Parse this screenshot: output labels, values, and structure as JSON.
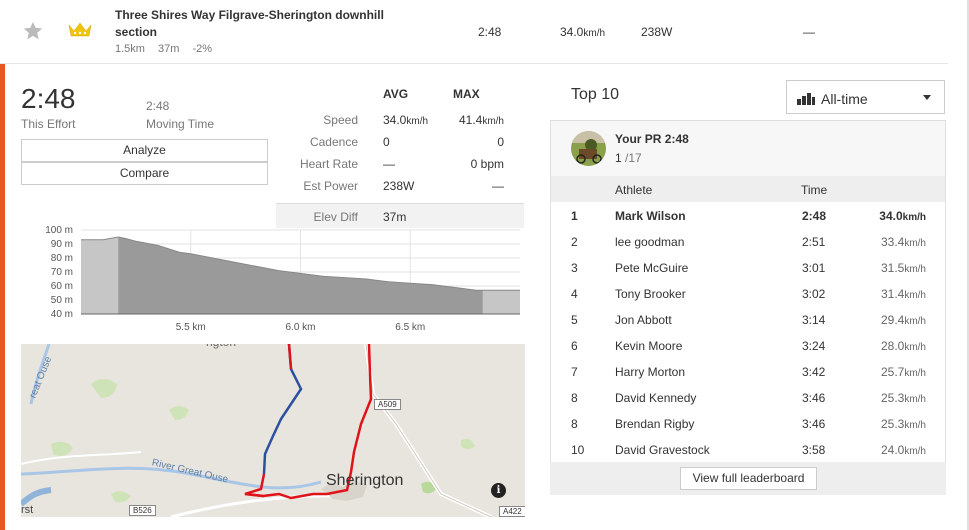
{
  "segment": {
    "name": "Three Shires Way Filgrave-Sherington downhill section",
    "distance": "1.5km",
    "elevation_gain": "37m",
    "grade": "-2%",
    "time": "2:48",
    "speed_value": "34.0",
    "speed_unit": "km/h",
    "power": "238W",
    "heart_rate": "—",
    "starred": false,
    "crown_color": "#f0c30f"
  },
  "effort": {
    "time": "2:48",
    "time_label": "This Effort",
    "moving_time": "2:48",
    "moving_time_label": "Moving Time",
    "analyze_label": "Analyze",
    "compare_label": "Compare"
  },
  "stats": {
    "avg_header": "AVG",
    "max_header": "MAX",
    "rows": [
      {
        "label": "Speed",
        "avg": "34.0",
        "avg_unit": "km/h",
        "max": "41.4",
        "max_unit": "km/h"
      },
      {
        "label": "Cadence",
        "avg": "0",
        "avg_unit": "",
        "max": "0",
        "max_unit": ""
      },
      {
        "label": "Heart Rate",
        "avg": "—",
        "avg_unit": "",
        "max": "0",
        "max_unit": " bpm"
      },
      {
        "label": "Est Power",
        "avg": "238W",
        "avg_unit": "",
        "max": "—",
        "max_unit": ""
      }
    ],
    "elev_label": "Elev Diff",
    "elev_value": "37m"
  },
  "chart_data": {
    "type": "area",
    "title": "",
    "xlabel": "",
    "ylabel": "",
    "x_ticks": [
      "5.5 km",
      "6.0 km",
      "6.5 km"
    ],
    "x_tick_values": [
      5.5,
      6.0,
      6.5
    ],
    "xlim": [
      5.0,
      7.0
    ],
    "y_ticks": [
      "100 m",
      "90 m",
      "80 m",
      "70 m",
      "60 m",
      "50 m",
      "40 m"
    ],
    "ylim": [
      40,
      100
    ],
    "grid": true,
    "highlight_range": [
      5.17,
      6.83
    ],
    "series": [
      {
        "x": [
          5.0,
          5.05,
          5.1,
          5.17,
          5.2,
          5.25,
          5.35,
          5.45,
          5.5,
          5.6,
          5.7,
          5.8,
          5.9,
          6.0,
          6.1,
          6.2,
          6.3,
          6.4,
          6.5,
          6.6,
          6.7,
          6.8,
          6.83,
          6.9,
          7.0
        ],
        "y": [
          93,
          93,
          93,
          95,
          94,
          92,
          89,
          84,
          83,
          80,
          77,
          74,
          71,
          69,
          67,
          66,
          65,
          63,
          62,
          61,
          59,
          57,
          57,
          57,
          57
        ]
      }
    ],
    "colors": {
      "area": "#c6c6c6",
      "area_highlight": "#9a9a9a",
      "line": "#888888"
    }
  },
  "map": {
    "town_label": "Sherington",
    "river_label": "River Great Ouse",
    "river_label_2": "reat Ouse",
    "road_a509": "A509",
    "road_b526": "B526",
    "road_a422": "A422",
    "info_icon": "i",
    "top_fragment": "ngton",
    "left_fragment": "rst"
  },
  "leaderboard": {
    "title": "Top 10",
    "period_label": "All-time",
    "pr_label": "Your PR 2:48",
    "pr_rank": "1",
    "pr_total": " /17",
    "col_athlete": "Athlete",
    "col_time": "Time",
    "rows": [
      {
        "rank": "1",
        "name": "Mark Wilson",
        "time": "2:48",
        "speed": "34.0",
        "unit": "km/h"
      },
      {
        "rank": "2",
        "name": "lee goodman",
        "time": "2:51",
        "speed": "33.4",
        "unit": "km/h"
      },
      {
        "rank": "3",
        "name": "Pete McGuire",
        "time": "3:01",
        "speed": "31.5",
        "unit": "km/h"
      },
      {
        "rank": "4",
        "name": "Tony Brooker",
        "time": "3:02",
        "speed": "31.4",
        "unit": "km/h"
      },
      {
        "rank": "5",
        "name": "Jon Abbott",
        "time": "3:14",
        "speed": "29.4",
        "unit": "km/h"
      },
      {
        "rank": "6",
        "name": "Kevin Moore",
        "time": "3:24",
        "speed": "28.0",
        "unit": "km/h"
      },
      {
        "rank": "7",
        "name": "Harry Morton",
        "time": "3:42",
        "speed": "25.7",
        "unit": "km/h"
      },
      {
        "rank": "8",
        "name": "David Kennedy",
        "time": "3:46",
        "speed": "25.3",
        "unit": "km/h"
      },
      {
        "rank": "8",
        "name": "Brendan Rigby",
        "time": "3:46",
        "speed": "25.3",
        "unit": "km/h"
      },
      {
        "rank": "10",
        "name": "David Gravestock",
        "time": "3:58",
        "speed": "24.0",
        "unit": "km/h"
      }
    ],
    "view_full_label": "View full leaderboard"
  },
  "colors": {
    "accent": "#e8571f",
    "route_red": "#e0121a",
    "route_blue": "#2c4fa0"
  }
}
